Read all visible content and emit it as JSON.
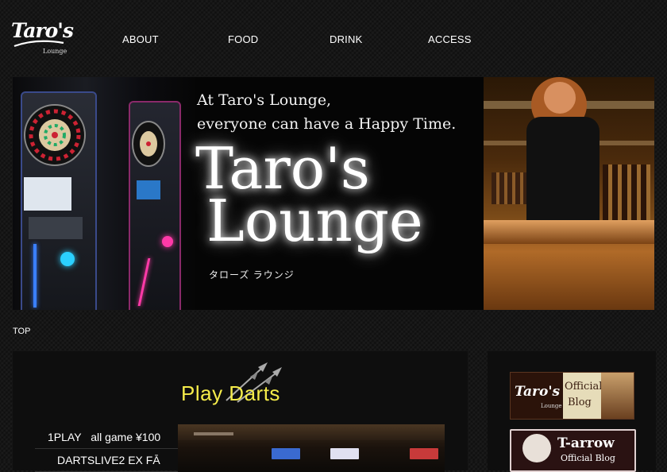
{
  "brand": {
    "logo_text": "Taro's",
    "logo_sub": "Lounge"
  },
  "nav": [
    {
      "label": "ABOUT"
    },
    {
      "label": "FOOD"
    },
    {
      "label": "DRINK"
    },
    {
      "label": "ACCESS"
    }
  ],
  "hero": {
    "tagline_1": "At Taro's Lounge,",
    "tagline_2": "everyone can have a Happy Time.",
    "title_1": "Taro's",
    "title_2": "Lounge",
    "kana": "タローズ ラウンジ"
  },
  "breadcrumb": "TOP",
  "section": {
    "title": "Play Darts",
    "price_items": [
      {
        "text": "1PLAY   all game ¥100"
      },
      {
        "text": "DARTSLIVE2 EX FĀ"
      }
    ]
  },
  "sidebar": {
    "banner1": {
      "logo": "Taro's",
      "logo_sub": "Lounge",
      "line1": "Official",
      "line2": "Blog"
    },
    "banner2": {
      "title": "T-arrow",
      "subtitle": "Official Blog"
    }
  },
  "colors": {
    "accent_yellow": "#f5ec4a",
    "background": "#161616",
    "panel": "#0e0e0e"
  }
}
